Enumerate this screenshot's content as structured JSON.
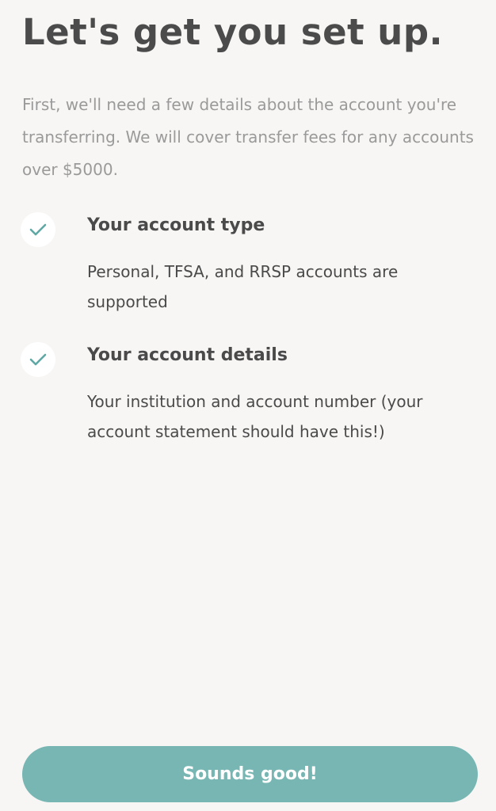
{
  "header": {
    "title": "Let's get you set up."
  },
  "intro": {
    "text": "First, we'll need a few details about the account you're transferring. We will cover transfer fees for any accounts over $5000."
  },
  "requirements": [
    {
      "icon": "check-icon",
      "title": "Your account type",
      "description": "Personal, TFSA, and RRSP accounts are supported"
    },
    {
      "icon": "check-icon",
      "title": "Your account details",
      "description": "Your institution and account number (your account statement should have this!)"
    }
  ],
  "actions": {
    "confirm_label": "Sounds good!"
  },
  "colors": {
    "accent": "#77b6b3",
    "check": "#5fa8a5",
    "background": "#f7f6f4",
    "heading": "#4b4b4b",
    "muted_text": "#9a9a9a"
  }
}
